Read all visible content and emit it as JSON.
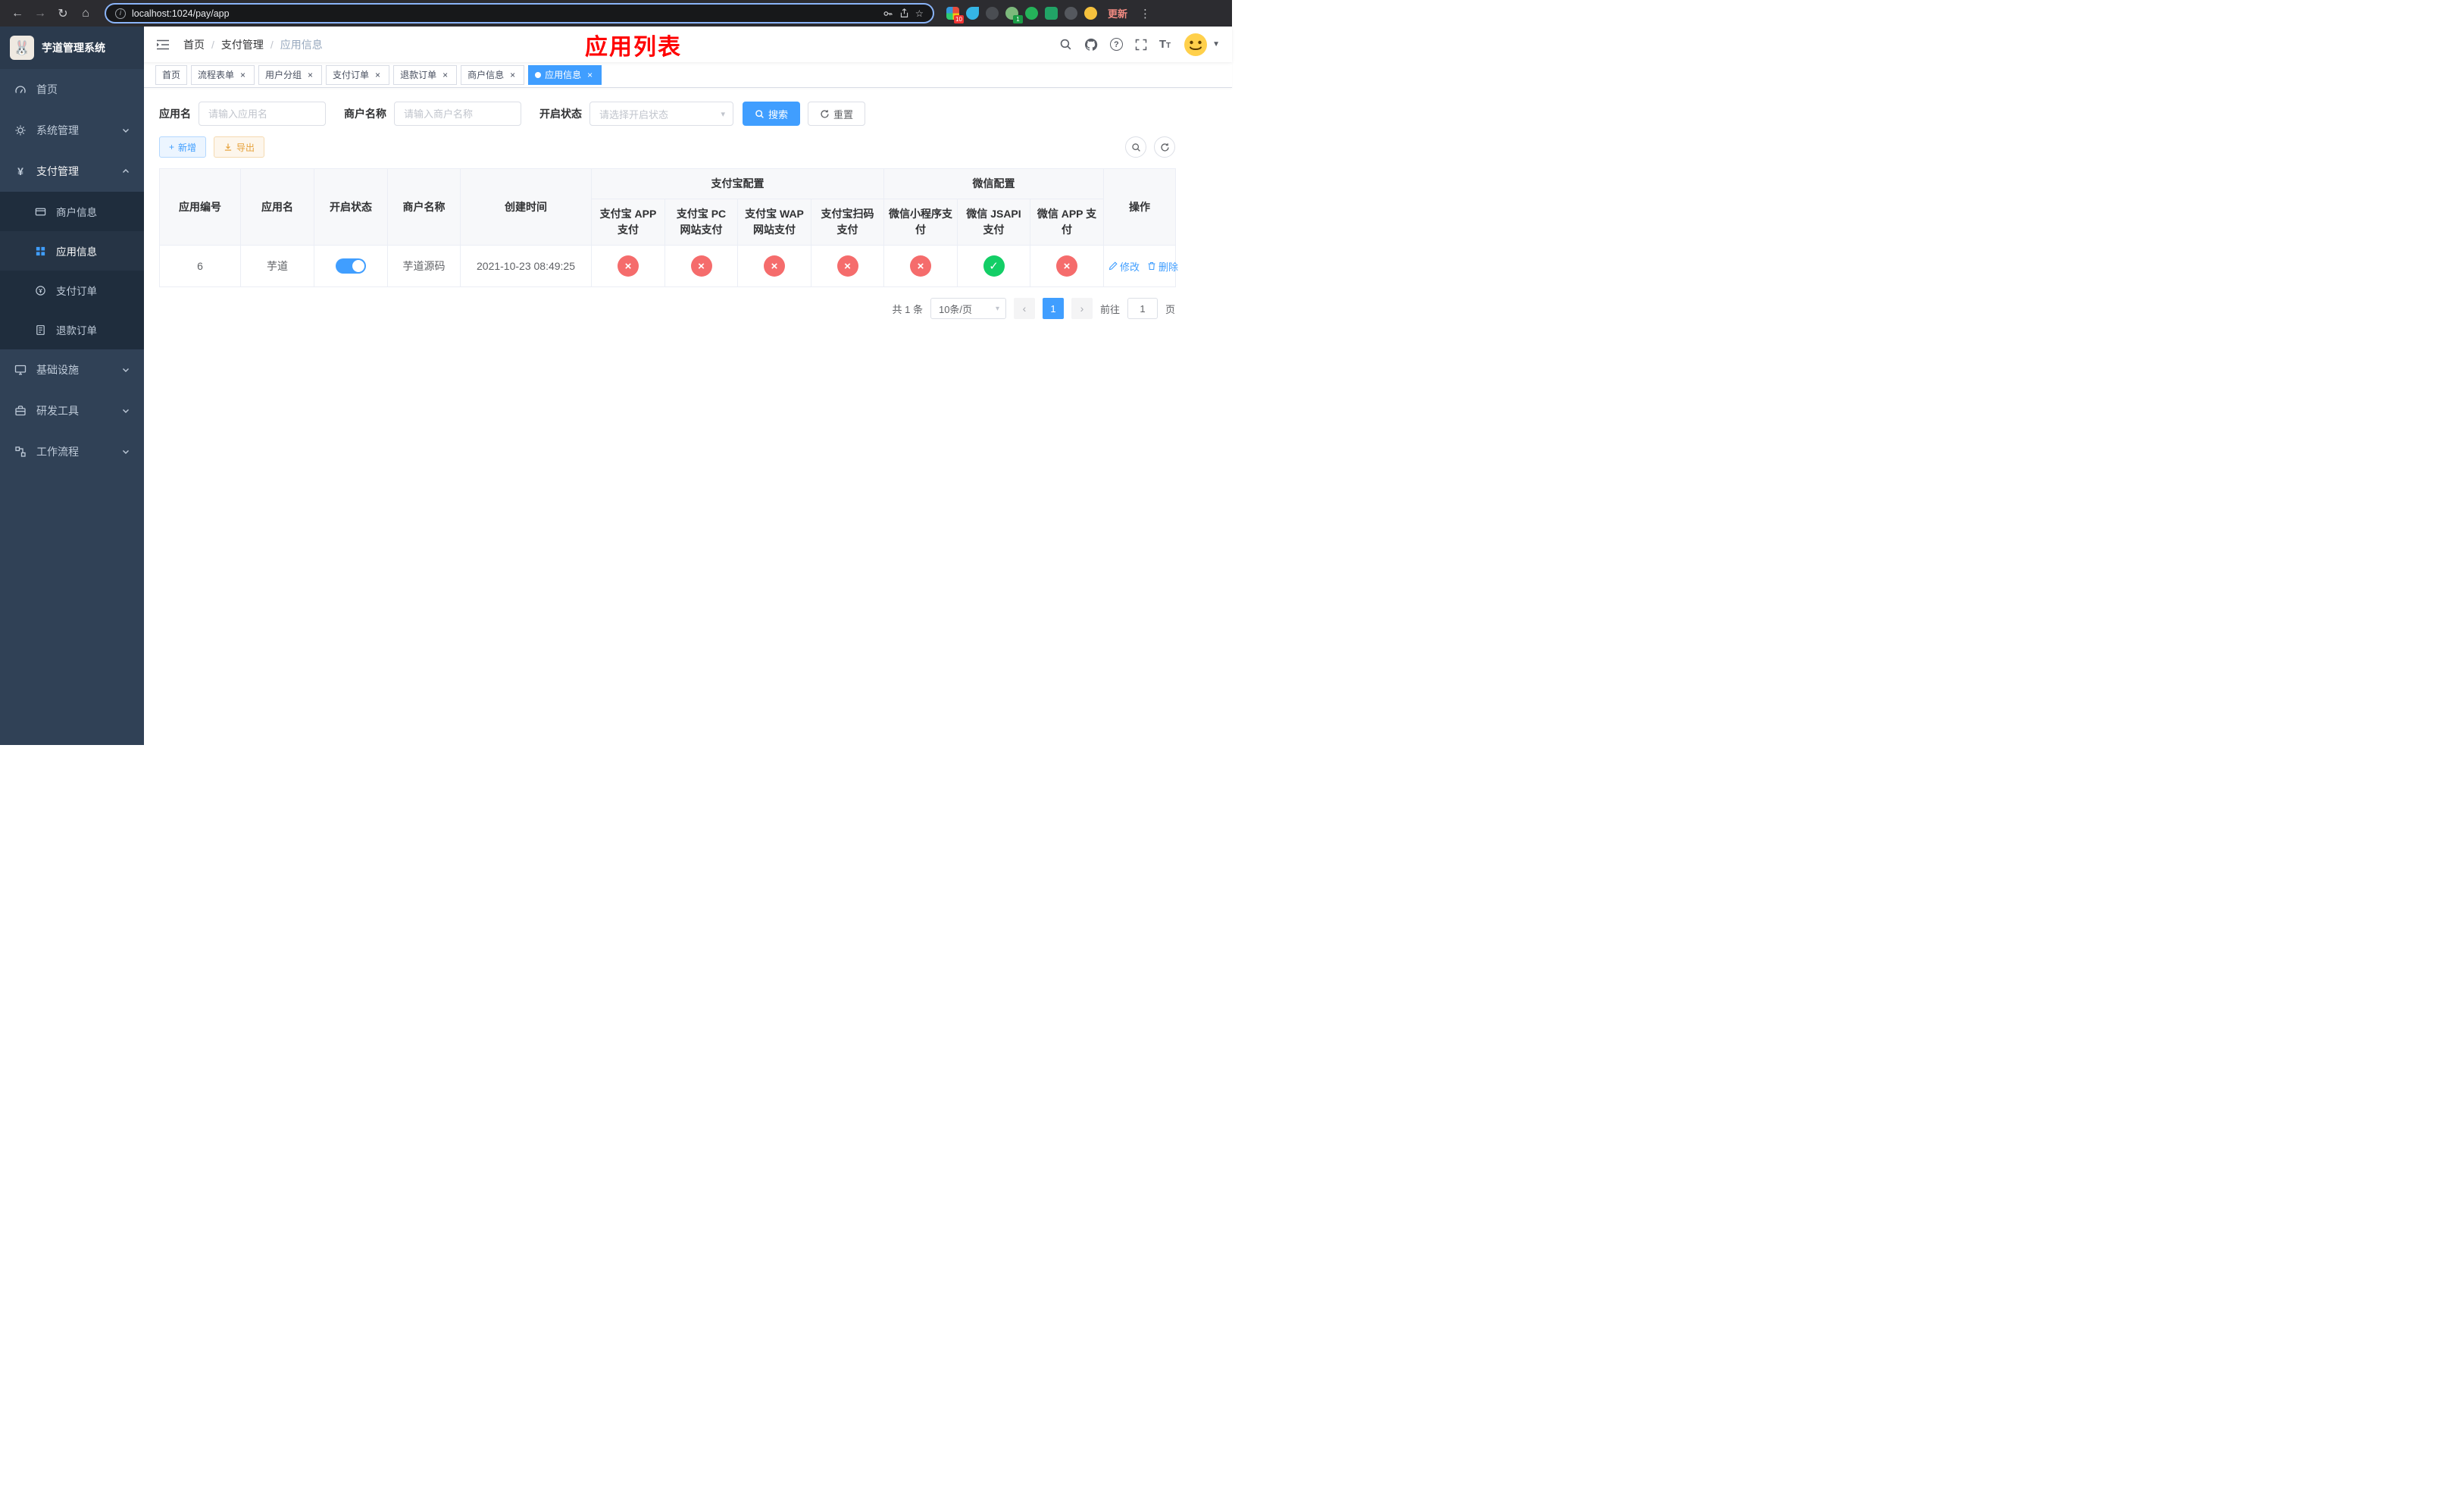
{
  "colors": {
    "accent": "#409eff",
    "danger": "#f56c6c",
    "success": "#13ce66",
    "sidebar_bg": "#304156",
    "title_red": "#ff0000"
  },
  "browser": {
    "url": "localhost:1024/pay/app",
    "update_label": "更新",
    "ext_badge_a": "10",
    "ext_badge_b": "1"
  },
  "sidebar": {
    "title": "芋道管理系统",
    "home": "首页",
    "system": "系统管理",
    "payment": "支付管理",
    "merchant_info": "商户信息",
    "app_info": "应用信息",
    "pay_order": "支付订单",
    "refund_order": "退款订单",
    "infra": "基础设施",
    "dev_tools": "研发工具",
    "workflow": "工作流程"
  },
  "header": {
    "breadcrumb": [
      "首页",
      "支付管理",
      "应用信息"
    ],
    "overlay_title": "应用列表"
  },
  "tabs": {
    "items": [
      {
        "label": "首页",
        "closable": false,
        "active": false
      },
      {
        "label": "流程表单",
        "closable": true,
        "active": false
      },
      {
        "label": "用户分组",
        "closable": true,
        "active": false
      },
      {
        "label": "支付订单",
        "closable": true,
        "active": false
      },
      {
        "label": "退款订单",
        "closable": true,
        "active": false
      },
      {
        "label": "商户信息",
        "closable": true,
        "active": false
      },
      {
        "label": "应用信息",
        "closable": true,
        "active": true
      }
    ]
  },
  "filters": {
    "app_name_label": "应用名",
    "app_name_placeholder": "请输入应用名",
    "merchant_label": "商户名称",
    "merchant_placeholder": "请输入商户名称",
    "status_label": "开启状态",
    "status_placeholder": "请选择开启状态",
    "search_label": "搜索",
    "reset_label": "重置"
  },
  "toolbar": {
    "add_label": "新增",
    "export_label": "导出"
  },
  "table": {
    "headers": {
      "app_id": "应用编号",
      "app_name": "应用名",
      "status": "开启状态",
      "merchant": "商户名称",
      "created": "创建时间",
      "alipay_group": "支付宝配置",
      "wechat_group": "微信配置",
      "actions": "操作",
      "sub": [
        "支付宝 APP 支付",
        "支付宝 PC 网站支付",
        "支付宝 WAP 网站支付",
        "支付宝扫码支付",
        "微信小程序支付",
        "微信 JSAPI 支付",
        "微信 APP 支付"
      ]
    },
    "rows": [
      {
        "id": "6",
        "name": "芋道",
        "enabled": true,
        "merchant": "芋道源码",
        "created": "2021-10-23 08:49:25",
        "configs": [
          "no",
          "no",
          "no",
          "no",
          "no",
          "yes",
          "no"
        ],
        "edit_label": "修改",
        "delete_label": "删除"
      }
    ]
  },
  "pagination": {
    "total": "共 1 条",
    "page_size": "10条/页",
    "current_page": "1",
    "goto_label": "前往",
    "goto_value": "1",
    "page_unit": "页"
  }
}
